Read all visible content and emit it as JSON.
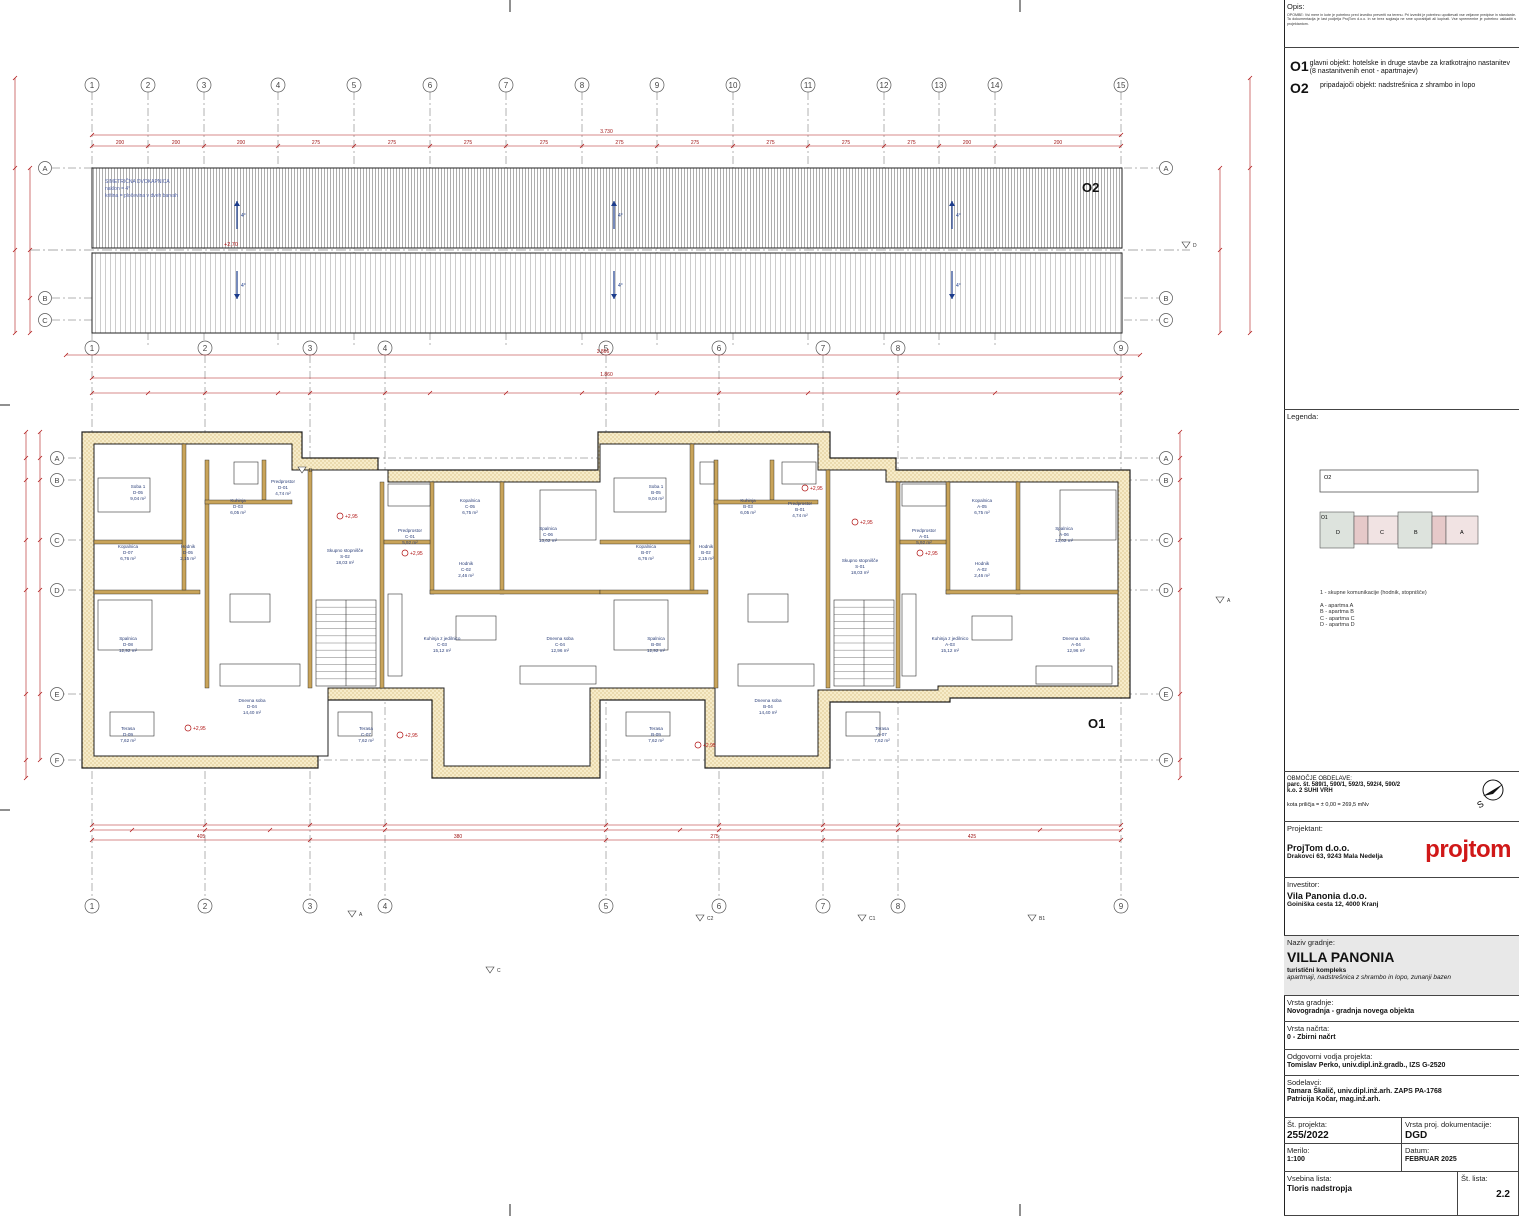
{
  "plan": {
    "grid_top": [
      "1",
      "2",
      "3",
      "4",
      "5",
      "6",
      "7",
      "8",
      "9",
      "10",
      "11",
      "12",
      "13",
      "14",
      "15"
    ],
    "grid_mid": [
      "1",
      "2",
      "3",
      "4",
      "5",
      "6",
      "7",
      "8",
      "9"
    ],
    "rows_roof": [
      "A",
      "B",
      "C"
    ],
    "rows_floor": [
      "A",
      "B",
      "C",
      "D",
      "E",
      "F"
    ],
    "roof_label": "O2",
    "floor_label": "O1",
    "roof_note": [
      "SIMETRIČNA DVOKAPNICA",
      "naklon = 4°",
      "kritina = pločevina v dveh barvah"
    ],
    "roof_slope": "4°",
    "roof_level": "+2,70",
    "overall_dim_top": "3.730",
    "overall_dim_mid": "3.866",
    "overall_dim_floor": "1.860",
    "dims_top": [
      "200",
      "200",
      "200",
      "275",
      "275",
      "275",
      "275",
      "275",
      "275",
      "275",
      "275",
      "275",
      "200",
      "200",
      "455"
    ],
    "dims_bottom": [
      "405",
      "380",
      "275",
      "425",
      "410",
      "440",
      "1.080",
      "425"
    ],
    "rooms": [
      {
        "name": "Soba 1",
        "code": "D-05",
        "area": "9,04 m²"
      },
      {
        "name": "Kuhinja",
        "code": "D-03",
        "area": "6,05 m²"
      },
      {
        "name": "Predprostor",
        "code": "D-01",
        "area": "4,74 m²"
      },
      {
        "name": "Kopalnica",
        "code": "D-07",
        "area": "6,76 m²"
      },
      {
        "name": "Hodnik",
        "code": "D-05",
        "area": "2,15 m²"
      },
      {
        "name": "Spalnica",
        "code": "D-08",
        "area": "12,92 m²"
      },
      {
        "name": "Dnevna soba",
        "code": "D-04",
        "area": "14,40 m²"
      },
      {
        "name": "Terasa",
        "code": "D-09",
        "area": "7,62 m²"
      },
      {
        "name": "Skupno stopnišče",
        "code": "S-02",
        "area": "18,03 m²"
      },
      {
        "name": "Predprostor",
        "code": "C-01",
        "area": "5,92 m²"
      },
      {
        "name": "Kopalnica",
        "code": "C-05",
        "area": "6,75 m²"
      },
      {
        "name": "Hodnik",
        "code": "C-02",
        "area": "2,46 m²"
      },
      {
        "name": "Spalnica",
        "code": "C-06",
        "area": "13,02 m²"
      },
      {
        "name": "Kuhinja z jedilnico",
        "code": "C-03",
        "area": "15,12 m²"
      },
      {
        "name": "Dnevna soba",
        "code": "C-04",
        "area": "12,96 m²"
      },
      {
        "name": "Terasa",
        "code": "C-07",
        "area": "7,62 m²"
      },
      {
        "name": "Soba 1",
        "code": "B-05",
        "area": "9,04 m²"
      },
      {
        "name": "Kuhinja",
        "code": "B-03",
        "area": "6,05 m²"
      },
      {
        "name": "Predprostor",
        "code": "B-01",
        "area": "4,74 m²"
      },
      {
        "name": "Kopalnica",
        "code": "B-07",
        "area": "6,76 m²"
      },
      {
        "name": "Hodnik",
        "code": "B-02",
        "area": "2,15 m²"
      },
      {
        "name": "Spalnica",
        "code": "B-08",
        "area": "12,92 m²"
      },
      {
        "name": "Dnevna soba",
        "code": "B-04",
        "area": "14,40 m²"
      },
      {
        "name": "Terasa",
        "code": "B-09",
        "area": "7,62 m²"
      },
      {
        "name": "Skupno stopnišče",
        "code": "S-01",
        "area": "18,03 m²"
      },
      {
        "name": "Predprostor",
        "code": "A-01",
        "area": "5,92 m²"
      },
      {
        "name": "Kopalnica",
        "code": "A-05",
        "area": "6,75 m²"
      },
      {
        "name": "Hodnik",
        "code": "A-02",
        "area": "2,46 m²"
      },
      {
        "name": "Spalnica",
        "code": "A-06",
        "area": "13,02 m²"
      },
      {
        "name": "Kuhinja z jedilnico",
        "code": "A-03",
        "area": "15,12 m²"
      },
      {
        "name": "Dnevna soba",
        "code": "A-04",
        "area": "12,96 m²"
      },
      {
        "name": "Terasa",
        "code": "A-07",
        "area": "7,62 m²"
      }
    ],
    "level_marks": [
      "+2,95",
      "+2,95",
      "+2,95",
      "+2,95",
      "+2,95",
      "+2,95",
      "+2,95",
      "+2,95"
    ],
    "section_marks": [
      "A",
      "A",
      "D",
      "B",
      "C2",
      "C1",
      "B1",
      "C"
    ]
  },
  "title_block": {
    "opis_label": "Opis:",
    "opis_note": "OPOMBE: Vsi mere in kote je potrebno pred izvedbo preveriti na terenu. Pri izvedbi je potrebno upoštevati vse veljavne predpise in standarde. Ta dokumentacija je last podjetja ProjTom d.o.o. in se brez soglasja ne sme uporabljati ali kopirati. Vse spremembe je potrebno uskladiti s projektantom.",
    "objects": [
      {
        "code": "O1",
        "desc": "glavni objekt: hotelske in druge stavbe za kratkotrajno nastanitev (8 nastanitvenih enot - apartmajev)"
      },
      {
        "code": "O2",
        "desc": "pripadajoči objekt: nadstrešnica z shrambo in lopo"
      }
    ],
    "legenda_label": "Legenda:",
    "legend_o2": "O2",
    "legend_o1": "O1",
    "legend_units": [
      "D",
      "C",
      "B",
      "A"
    ],
    "legend_items": [
      "1 - skupne komunikacije (hodnik, stopnišče)",
      "A - apartma A",
      "B - apartma B",
      "C - apartma C",
      "D - apartma D"
    ],
    "obmocje_label": "OBMOČJE OBDELAVE:",
    "parcele": "parc. št. 589/1, 590/1, 592/3, 592/4, 590/2",
    "ko": "k.o. 2 SUHI VRH",
    "kota": "kota priličja = ± 0,00 = 269,5 mNv",
    "north_label": "S",
    "projektant_label": "Projektant:",
    "projektant_name": "ProjTom d.o.o.",
    "projektant_addr": "Drakovci 63, 9243 Mala Nedelja",
    "logo_text": "projtom",
    "investitor_label": "Investitor:",
    "investitor_name": "Vila Panonia d.o.o.",
    "investitor_addr": "Goiniška cesta 12, 4000 Kranj",
    "naziv_label": "Naziv gradnje:",
    "naziv": "VILLA PANONIA",
    "naziv_sub": "turistični kompleks",
    "naziv_desc": "apartmaji, nadstrešnica z shrambo in lopo, zunanji bazen",
    "vrsta_gradnje_label": "Vrsta gradnje:",
    "vrsta_gradnje": "Novogradnja - gradnja novega objekta",
    "vrsta_nacrta_label": "Vrsta načrta:",
    "vrsta_nacrta": "0 - Zbirni načrt",
    "vodja_label": "Odgovorni vodja projekta:",
    "vodja": "Tomislav Perko, univ.dipl.inž.gradb., IZS G-2520",
    "sodelavci_label": "Sodelavci:",
    "sodelavci": [
      "Tamara Škalič, univ.dipl.inž.arh. ZAPS PA-1768",
      "Patricija Kočar, mag.inž.arh."
    ],
    "st_projekta_label": "Št. projekta:",
    "st_projekta": "255/2022",
    "vrsta_dok_label": "Vrsta proj. dokumentacije:",
    "vrsta_dok": "DGD",
    "merilo_label": "Merilo:",
    "merilo": "1:100",
    "datum_label": "Datum:",
    "datum": "FEBRUAR 2025",
    "vsebina_label": "Vsebina lista:",
    "vsebina": "Tloris nadstropja",
    "st_lista_label": "Št. lista:",
    "st_lista": "2.2"
  }
}
